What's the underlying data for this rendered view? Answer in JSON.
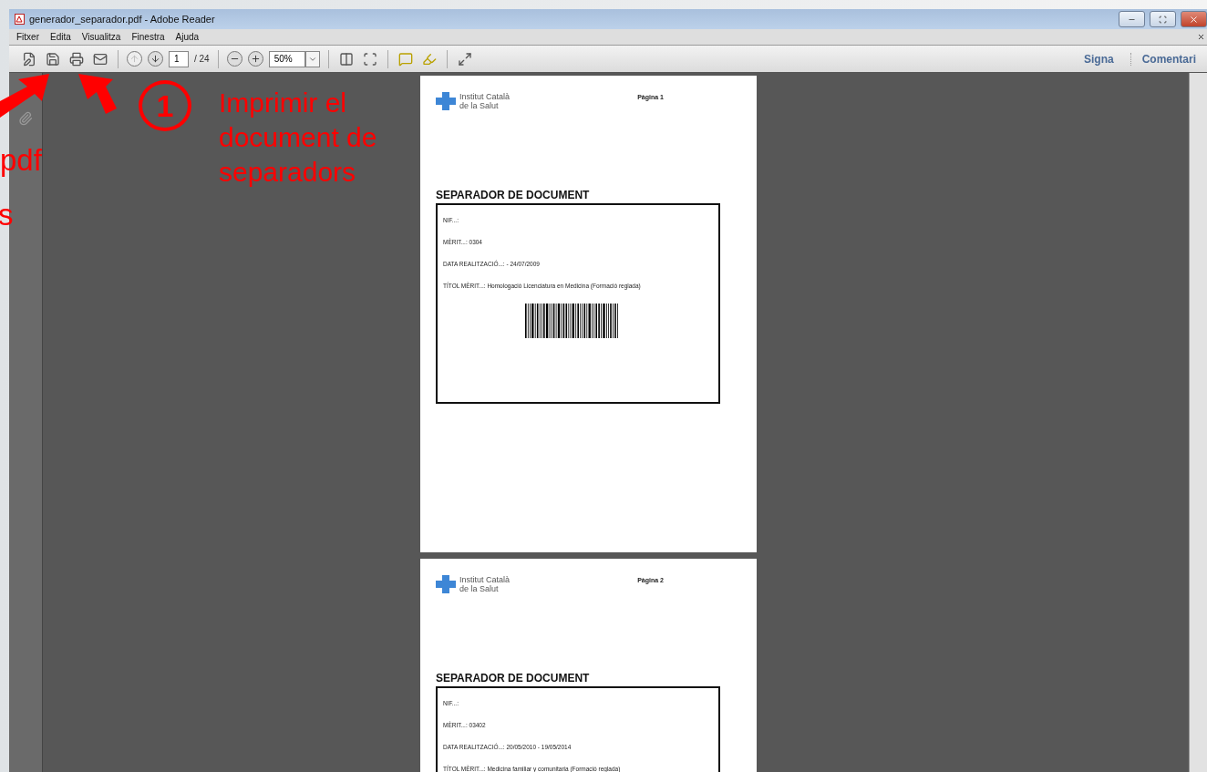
{
  "window": {
    "title": "generador_separador.pdf - Adobe Reader"
  },
  "menu": [
    {
      "label": "Fitxer"
    },
    {
      "label": "Edita"
    },
    {
      "label": "Visualitza"
    },
    {
      "label": "Finestra"
    },
    {
      "label": "Ajuda"
    }
  ],
  "toolbar": {
    "page_current": "1",
    "page_total": "/ 24",
    "zoom": "50%"
  },
  "panels": [
    {
      "label": "Signa"
    },
    {
      "label": "Comentari"
    }
  ],
  "pages": [
    {
      "logo_line_1": "Institut Català",
      "logo_line_2": "de la Salut",
      "page_label": "Pàgina 1",
      "heading": "SEPARADOR DE DOCUMENT",
      "fields": [
        "NIF...:",
        "MÈRIT...: 0304",
        "DATA REALITZACIÓ...:  - 24/07/2009",
        "TÍTOL MÈRIT...: Homologació Licenciatura en Medicina (Formació reglada)"
      ],
      "barcode": true
    },
    {
      "logo_line_1": "Institut Català",
      "logo_line_2": "de la Salut",
      "page_label": "Pàgina 2",
      "heading": "SEPARADOR DE DOCUMENT",
      "fields": [
        "NIF...:",
        "MÈRIT...: 03402",
        "DATA REALITZACIÓ...: 20/05/2010 - 19/05/2014",
        "TÍTOL MÈRIT...: Medicina familiar y comunitaria (Formació reglada)"
      ]
    }
  ],
  "annotations": {
    "step_number": "1",
    "step_text": "Imprimir el document de separadors",
    "left_fragments": [
      "pdf",
      "s"
    ]
  }
}
